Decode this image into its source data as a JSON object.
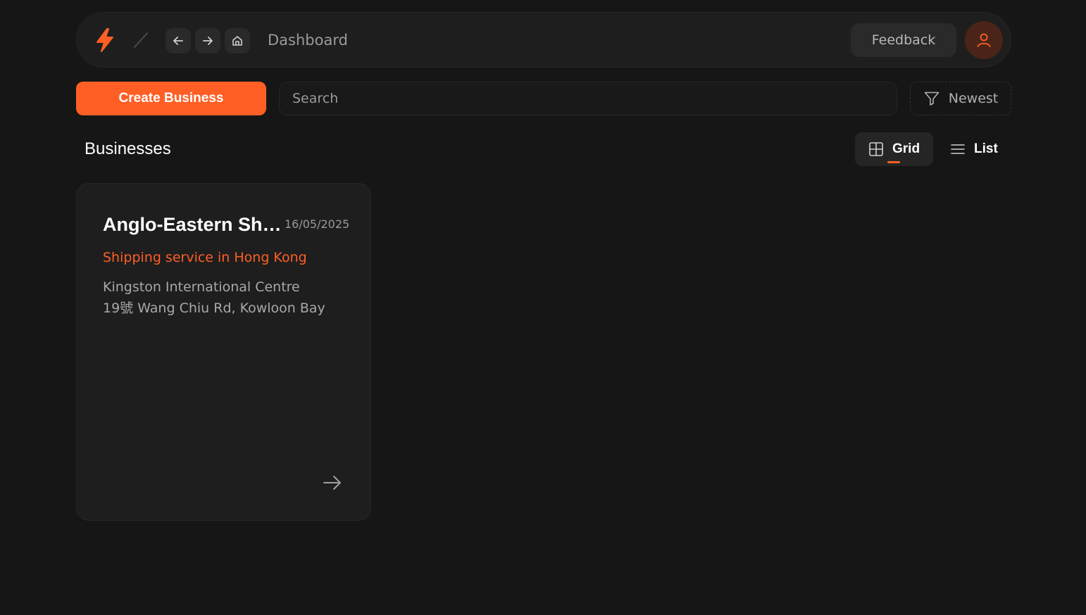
{
  "topbar": {
    "title": "Dashboard",
    "feedback_label": "Feedback",
    "accent_color": "#ff5f25"
  },
  "toolbar": {
    "create_label": "Create Business",
    "search_placeholder": "Search",
    "sort_label": "Newest"
  },
  "section": {
    "title": "Businesses",
    "grid_label": "Grid",
    "list_label": "List",
    "active_view": "Grid"
  },
  "businesses": [
    {
      "name": "Anglo-Eastern Shipping",
      "date": "16/05/2025",
      "tagline": "Shipping service in Hong Kong",
      "address_line1": "Kingston International Centre",
      "address_line2": "19號 Wang Chiu Rd, Kowloon Bay"
    }
  ]
}
